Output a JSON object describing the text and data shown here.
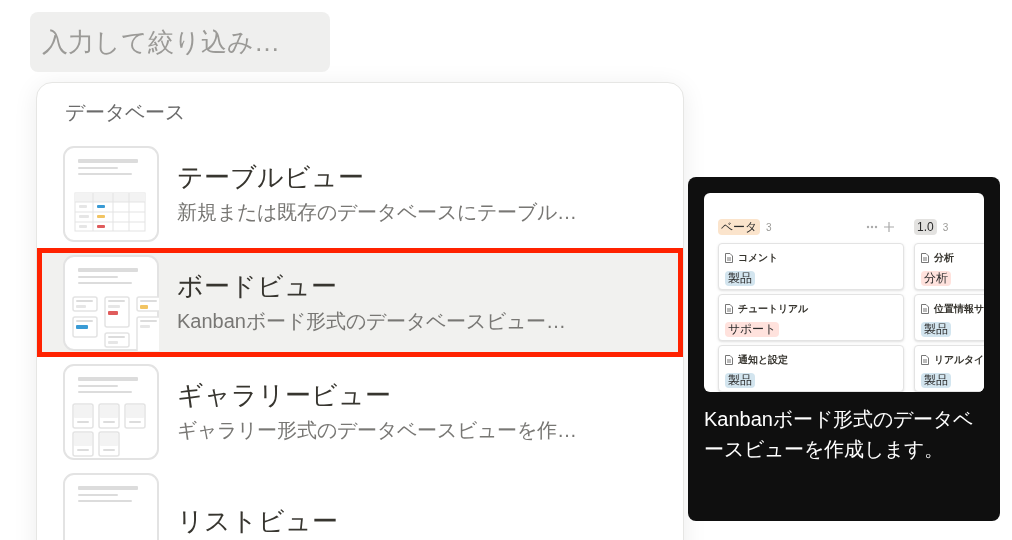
{
  "search": {
    "placeholder": "入力して絞り込み…"
  },
  "menu": {
    "section": "データベース",
    "items": [
      {
        "kind": "table",
        "title": "テーブルビュー",
        "description": "新規または既存のデータベースにテーブル…",
        "selected": false
      },
      {
        "kind": "board",
        "title": "ボードビュー",
        "description": "Kanbanボード形式のデータベースビュー…",
        "selected": true
      },
      {
        "kind": "gallery",
        "title": "ギャラリービュー",
        "description": "ギャラリー形式のデータベースビューを作…",
        "selected": false
      },
      {
        "kind": "list",
        "title": "リストビュー",
        "selected": false
      }
    ]
  },
  "preview": {
    "columns": [
      {
        "tag": "ベータ",
        "color": "#fbe4cc",
        "count": "3",
        "cards": [
          {
            "title": "コメント",
            "tag": "製品",
            "color": "#d3e5ef"
          },
          {
            "title": "チュートリアル",
            "tag": "サポート",
            "color": "#ffe2dd"
          },
          {
            "title": "通知と設定",
            "tag": "製品",
            "color": "#d3e5ef"
          }
        ]
      },
      {
        "tag": "1.0",
        "color": "#e3e2e0",
        "count": "3",
        "cards": [
          {
            "title": "分析",
            "tag": "分析",
            "color": "#ffe2dd"
          },
          {
            "title": "位置情報サ",
            "tag": "製品",
            "color": "#d3e5ef"
          },
          {
            "title": "リアルタイ",
            "tag": "製品",
            "color": "#d3e5ef"
          }
        ]
      }
    ],
    "caption": "Kanbanボード形式のデータベースビューを作成します。"
  }
}
